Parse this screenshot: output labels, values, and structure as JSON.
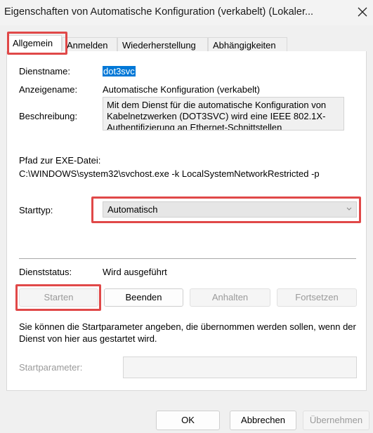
{
  "window": {
    "title": "Eigenschaften von Automatische Konfiguration (verkabelt) (Lokaler...",
    "close_icon": "close-icon"
  },
  "tabs": [
    {
      "label": "Allgemein",
      "active": true
    },
    {
      "label": "Anmelden",
      "active": false
    },
    {
      "label": "Wiederherstellung",
      "active": false
    },
    {
      "label": "Abhängigkeiten",
      "active": false
    }
  ],
  "general": {
    "service_name_label": "Dienstname:",
    "service_name_value": "dot3svc",
    "display_name_label": "Anzeigename:",
    "display_name_value": "Automatische Konfiguration (verkabelt)",
    "description_label": "Beschreibung:",
    "description_value": "Mit dem Dienst für die automatische Konfiguration von Kabelnetzwerken (DOT3SVC) wird eine IEEE 802.1X-Authentifizierung an Ethernet-Schnittstellen",
    "exe_path_label": "Pfad zur EXE-Datei:",
    "exe_path_value": "C:\\WINDOWS\\system32\\svchost.exe -k LocalSystemNetworkRestricted -p",
    "startup_type_label": "Starttyp:",
    "startup_type_value": "Automatisch",
    "status_label": "Dienststatus:",
    "status_value": "Wird ausgeführt",
    "buttons": {
      "start": "Starten",
      "stop": "Beenden",
      "pause": "Anhalten",
      "resume": "Fortsetzen"
    },
    "hint": "Sie können die Startparameter angeben, die übernommen werden sollen, wenn der Dienst von hier aus gestartet wird.",
    "start_params_label": "Startparameter:",
    "start_params_value": ""
  },
  "footer": {
    "ok": "OK",
    "cancel": "Abbrechen",
    "apply": "Übernehmen"
  },
  "colors": {
    "highlight": "#e04848",
    "selection": "#0078d7"
  }
}
